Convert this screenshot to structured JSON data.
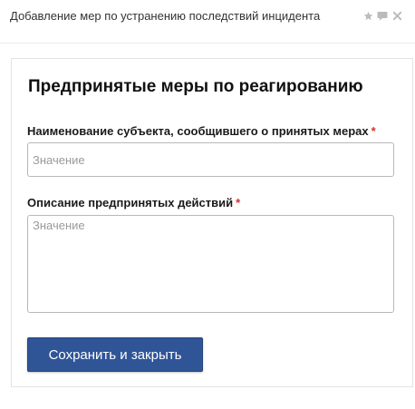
{
  "window": {
    "title": "Добавление мер по устранению последствий инцидента",
    "icons": [
      "star-icon",
      "comment-icon",
      "close-icon"
    ]
  },
  "form": {
    "heading": "Предпринятые меры по реагированию",
    "fields": [
      {
        "label": "Наименование субъекта, сообщившего о принятых мерах",
        "required_mark": "*",
        "placeholder": "Значение",
        "value": ""
      },
      {
        "label": "Описание предпринятых действий",
        "required_mark": "*",
        "placeholder": "Значение",
        "value": ""
      }
    ],
    "save_label": "Сохранить и закрыть"
  },
  "colors": {
    "button_bg": "#2f5597",
    "required": "#d9302c",
    "icon": "#bbbbbb"
  }
}
